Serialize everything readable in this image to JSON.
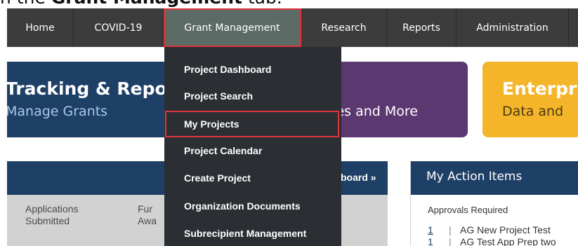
{
  "caption": {
    "prefix": "n the ",
    "bold": "Grant Management",
    "suffix": " tab."
  },
  "nav": {
    "items": [
      {
        "label": "Home"
      },
      {
        "label": "COVID-19"
      },
      {
        "label": "Grant Management"
      },
      {
        "label": "Research"
      },
      {
        "label": "Reports"
      },
      {
        "label": "Administration"
      }
    ]
  },
  "banners": [
    {
      "title": "Tracking & Repo",
      "subtitle": "Manage Grants"
    },
    {
      "title": "",
      "subtitle": "ces and More"
    },
    {
      "title": "Enterpri",
      "subtitle": "Data and"
    }
  ],
  "dropdown": {
    "items": [
      {
        "label": "Project Dashboard"
      },
      {
        "label": "Project Search"
      },
      {
        "label": "My Projects"
      },
      {
        "label": "Project Calendar"
      },
      {
        "label": "Create Project"
      },
      {
        "label": "Organization Documents"
      },
      {
        "label": "Subrecipient Management"
      }
    ]
  },
  "stats_panel": {
    "dashboard_link": "board »",
    "stats": [
      {
        "line1": "Applications",
        "line2": "Submitted"
      },
      {
        "line1": "Fur",
        "line2": "Awa"
      }
    ]
  },
  "action_items": {
    "title": "My Action Items",
    "approvals_label": "Approvals Required",
    "rows": [
      {
        "count": "1",
        "sep": "|",
        "text": "AG New Project Test"
      },
      {
        "count": "1",
        "sep": "|",
        "text": "AG Test App Prep two"
      }
    ]
  },
  "colors": {
    "navbar": "#3c3c3c",
    "active_tab": "#5c6b66",
    "highlight_border": "#e0343c",
    "dropdown": "#2b2f33",
    "blue_banner": "#1e3f66",
    "purple_banner": "#5c3871",
    "yellow_banner": "#f5b52a"
  }
}
